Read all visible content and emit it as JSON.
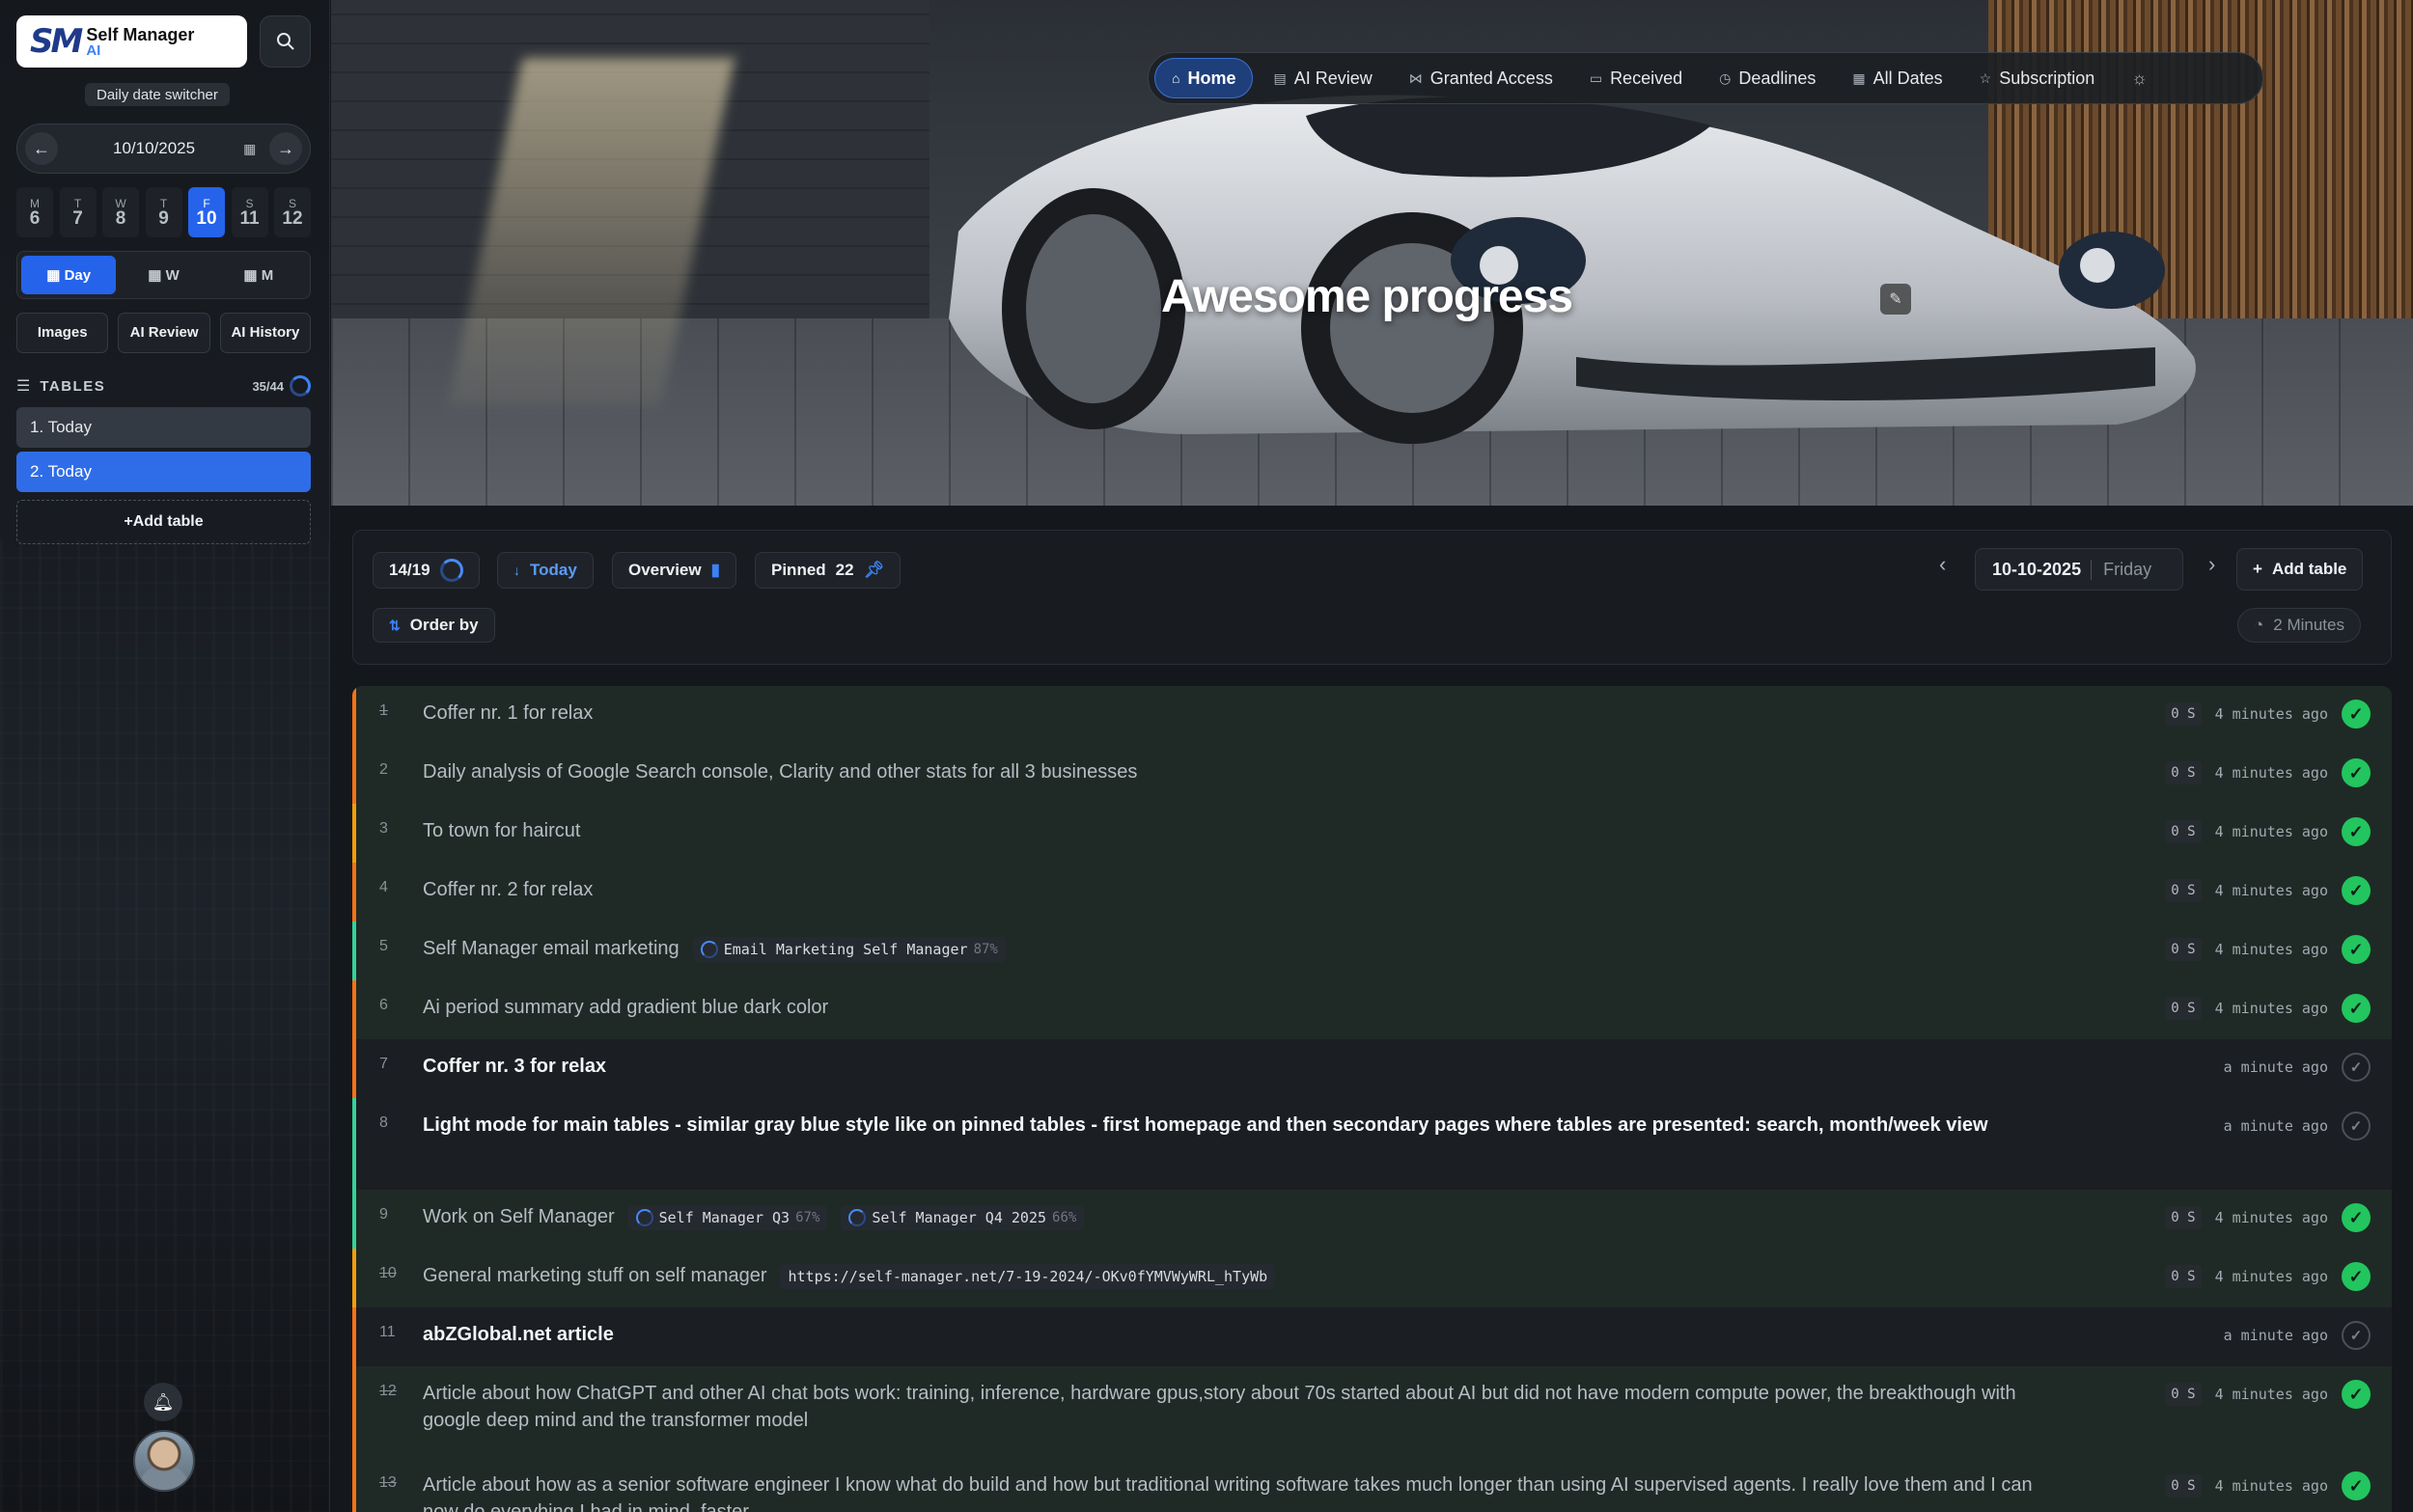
{
  "app": {
    "logo_mark": "SM",
    "logo_title": "Self Manager",
    "logo_sub": "AI"
  },
  "sidebar": {
    "tooltip": "Daily date switcher",
    "date": "10/10/2025",
    "weekdays": [
      {
        "l": "M",
        "n": "6"
      },
      {
        "l": "T",
        "n": "7"
      },
      {
        "l": "W",
        "n": "8"
      },
      {
        "l": "T",
        "n": "9"
      },
      {
        "l": "F",
        "n": "10"
      },
      {
        "l": "S",
        "n": "11"
      },
      {
        "l": "S",
        "n": "12"
      }
    ],
    "views": [
      "Day",
      "W",
      "M"
    ],
    "tools": [
      "Images",
      "AI Review",
      "AI History"
    ],
    "tables_label": "TABLES",
    "tables_count": "35/44",
    "tables": [
      "1. Today",
      "2. Today"
    ],
    "add_table": "+Add table"
  },
  "nav": [
    {
      "label": "Home",
      "icon": "home-icon"
    },
    {
      "label": "AI Review",
      "icon": "review-icon"
    },
    {
      "label": "Granted Access",
      "icon": "share-icon"
    },
    {
      "label": "Received",
      "icon": "inbox-icon"
    },
    {
      "label": "Deadlines",
      "icon": "clock-icon"
    },
    {
      "label": "All Dates",
      "icon": "calendar-icon"
    },
    {
      "label": "Subscription",
      "icon": "star-icon"
    }
  ],
  "hero": {
    "title": "Awesome progress"
  },
  "toolbar": {
    "progress": "14/19",
    "today": "Today",
    "overview": "Overview",
    "pinned_label": "Pinned",
    "pinned_count": "22",
    "order_by": "Order by",
    "date": "10-10-2025",
    "weekday": "Friday",
    "add_table": "Add table",
    "timer": "2 Minutes"
  },
  "rows": [
    {
      "n": "1",
      "text": "Coffer nr. 1 for relax",
      "done": true,
      "strike": true,
      "color": "#f97316",
      "ago": "4 minutes ago",
      "tags": []
    },
    {
      "n": "2",
      "text": "Daily analysis of Google Search console, Clarity and other stats for all 3 businesses",
      "done": true,
      "strike": false,
      "color": "#f97316",
      "ago": "4 minutes ago",
      "tags": []
    },
    {
      "n": "3",
      "text": "To town for haircut",
      "done": true,
      "strike": false,
      "color": "#f59e0b",
      "ago": "4 minutes ago",
      "tags": []
    },
    {
      "n": "4",
      "text": "Coffer nr. 2 for relax",
      "done": true,
      "strike": false,
      "color": "#f97316",
      "ago": "4 minutes ago",
      "tags": []
    },
    {
      "n": "5",
      "text": "Self Manager email marketing",
      "done": true,
      "strike": false,
      "color": "#34d399",
      "ago": "4 minutes ago",
      "tags": [
        {
          "label": "Email Marketing Self Manager",
          "pct": "87%"
        }
      ]
    },
    {
      "n": "6",
      "text": "Ai period summary add gradient blue dark color",
      "done": true,
      "strike": false,
      "color": "#f97316",
      "ago": "4 minutes ago",
      "tags": []
    },
    {
      "n": "7",
      "text": "Coffer nr. 3 for relax",
      "done": false,
      "strike": false,
      "color": "#f97316",
      "ago": "a minute ago",
      "tags": []
    },
    {
      "n": "8",
      "text": "Light mode for main tables - similar gray blue style like on pinned tables - first homepage and then secondary pages where tables are presented: search, month/week view",
      "done": false,
      "strike": false,
      "color": "#34d399",
      "ago": "a minute ago",
      "tags": []
    },
    {
      "n": "9",
      "text": "Work on Self Manager",
      "done": true,
      "strike": false,
      "color": "#34d399",
      "ago": "4 minutes ago",
      "tags": [
        {
          "label": "Self Manager Q3",
          "pct": "67%"
        },
        {
          "label": "Self Manager Q4 2025",
          "pct": "66%"
        }
      ]
    },
    {
      "n": "10",
      "text": "General marketing stuff on self manager",
      "done": true,
      "strike": true,
      "color": "#f59e0b",
      "ago": "4 minutes ago",
      "tags": [
        {
          "label": "https://self-manager.net/7-19-2024/-OKv0fYMVWyWRL_hTyWb",
          "pct": ""
        }
      ]
    },
    {
      "n": "11",
      "text": "abZGlobal.net article",
      "done": false,
      "strike": false,
      "color": "#f97316",
      "ago": "a minute ago",
      "tags": []
    },
    {
      "n": "12",
      "text": "Article about how ChatGPT and other AI chat bots work: training, inference, hardware gpus,story about 70s started about AI but did not have modern compute power, the breakthough with google deep mind and the transformer model",
      "done": true,
      "strike": true,
      "color": "#f97316",
      "ago": "4 minutes ago",
      "tags": []
    },
    {
      "n": "13",
      "text": "Article about how as a senior software engineer I know what do build and how but traditional writing software takes much longer than using AI supervised agents. I really love them and I can now do everyhing I had in mind, faster",
      "done": true,
      "strike": true,
      "color": "#f97316",
      "ago": "4 minutes ago",
      "tags": []
    }
  ],
  "row_badge": "0 S",
  "colors": {
    "accent": "#2563eb",
    "done": "#22c55e"
  }
}
